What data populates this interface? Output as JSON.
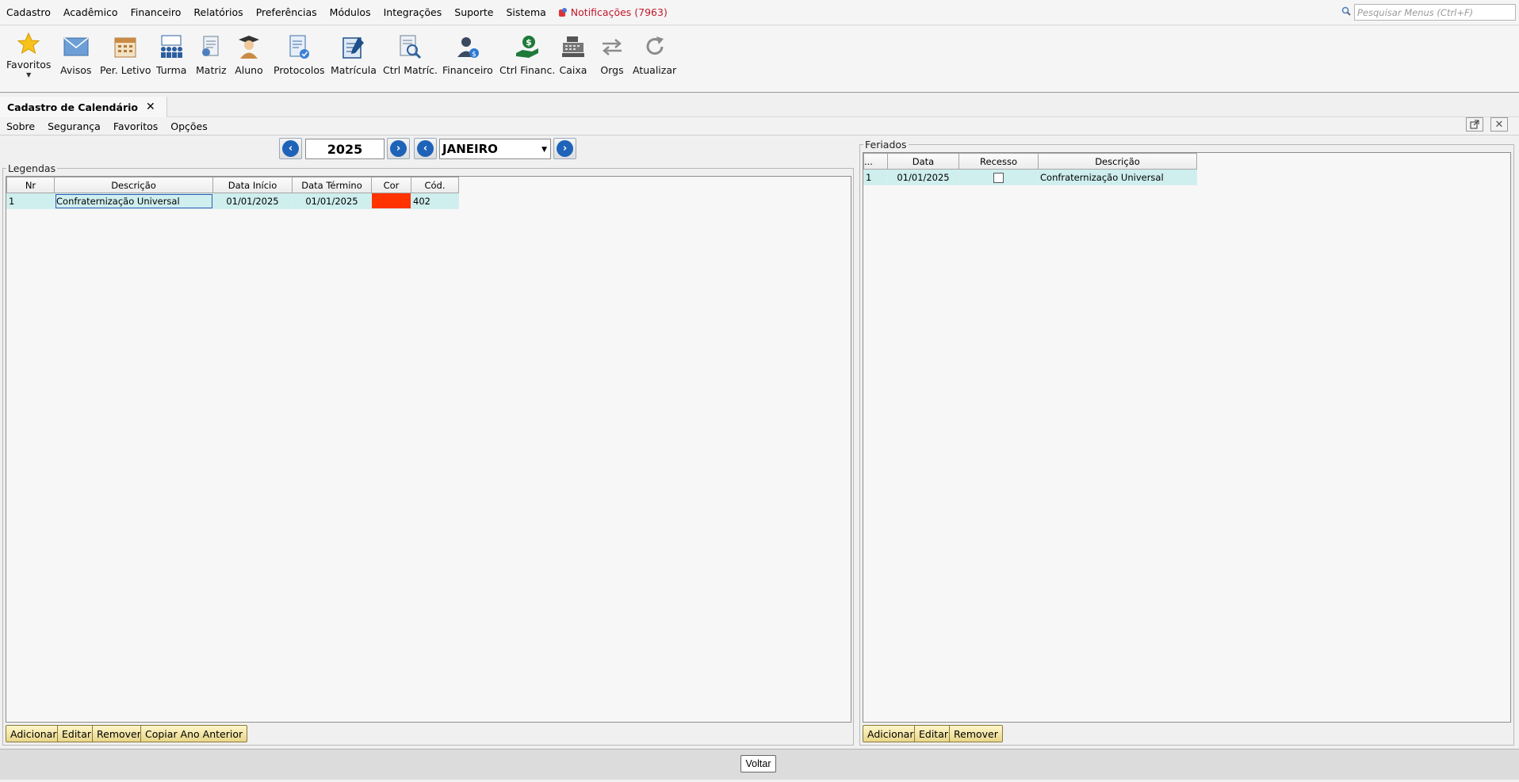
{
  "menubar": {
    "items": [
      "Cadastro",
      "Acadêmico",
      "Financeiro",
      "Relatórios",
      "Preferências",
      "Módulos",
      "Integrações",
      "Suporte",
      "Sistema"
    ],
    "notifications": "Notificações (7963)",
    "search_placeholder": "Pesquisar Menus (Ctrl+F)"
  },
  "toolbar": {
    "favoritos": "Favoritos",
    "avisos": "Avisos",
    "per_letivo": "Per. Letivo",
    "turma": "Turma",
    "matriz": "Matriz",
    "aluno": "Aluno",
    "protocolos": "Protocolos",
    "matricula": "Matrícula",
    "ctrl_matric": "Ctrl Matríc.",
    "financeiro": "Financeiro",
    "ctrl_financ": "Ctrl Financ.",
    "caixa": "Caixa",
    "orgs": "Orgs",
    "atualizar": "Atualizar"
  },
  "tab": {
    "title": "Cadastro de Calendário"
  },
  "submenu": {
    "items": [
      "Sobre",
      "Segurança",
      "Favoritos",
      "Opções"
    ]
  },
  "nav": {
    "year": "2025",
    "month": "JANEIRO"
  },
  "legendas": {
    "title": "Legendas",
    "columns": [
      "Nr",
      "Descrição",
      "Data Início",
      "Data Término",
      "Cor",
      "Cód."
    ],
    "rows": [
      {
        "nr": "1",
        "descricao": "Confraternização Universal",
        "inicio": "01/01/2025",
        "termino": "01/01/2025",
        "cor": "#ff3300",
        "cod": "402"
      }
    ],
    "buttons": [
      "Adicionar",
      "Editar",
      "Remover",
      "Copiar Ano Anterior"
    ]
  },
  "feriados": {
    "title": "Feriados",
    "columns": [
      "...",
      "Data",
      "Recesso",
      "Descrição"
    ],
    "rows": [
      {
        "n": "1",
        "data": "01/01/2025",
        "recesso": false,
        "descricao": "Confraternização Universal"
      }
    ],
    "buttons": [
      "Adicionar",
      "Editar",
      "Remover"
    ]
  },
  "footer": {
    "voltar": "Voltar"
  }
}
